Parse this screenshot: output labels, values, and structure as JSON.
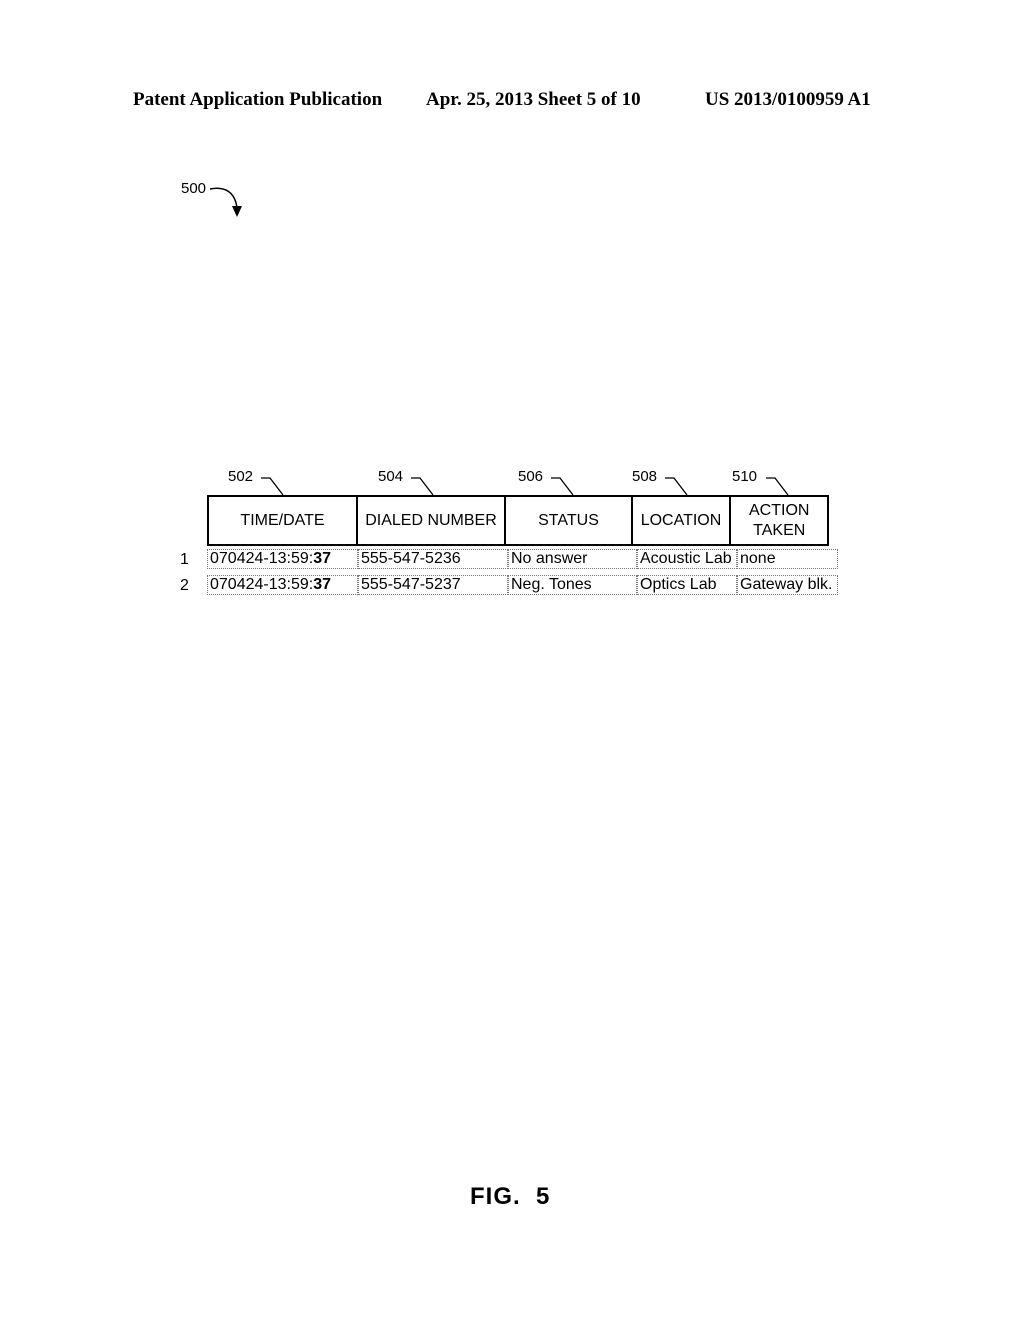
{
  "header": {
    "left": "Patent Application Publication",
    "center": "Apr. 25, 2013  Sheet 5 of 10",
    "right": "US 2013/0100959 A1"
  },
  "figure_ref": "500",
  "column_refs": [
    "502",
    "504",
    "506",
    "508",
    "510"
  ],
  "table": {
    "columns": [
      "TIME/DATE",
      "DIALED NUMBER",
      "STATUS",
      "LOCATION",
      "ACTION TAKEN"
    ],
    "rows": [
      {
        "num": "1",
        "time_prefix": "070424-13:59:",
        "time_bold": "37",
        "number": "555-547-5236",
        "status": "No answer",
        "location": "Acoustic Lab",
        "action": "none"
      },
      {
        "num": "2",
        "time_prefix": "070424-13:59:",
        "time_bold": "37",
        "number": "555-547-5237",
        "status": "Neg. Tones",
        "location": "Optics Lab",
        "action": "Gateway blk."
      }
    ]
  },
  "caption": "FIG.  5"
}
